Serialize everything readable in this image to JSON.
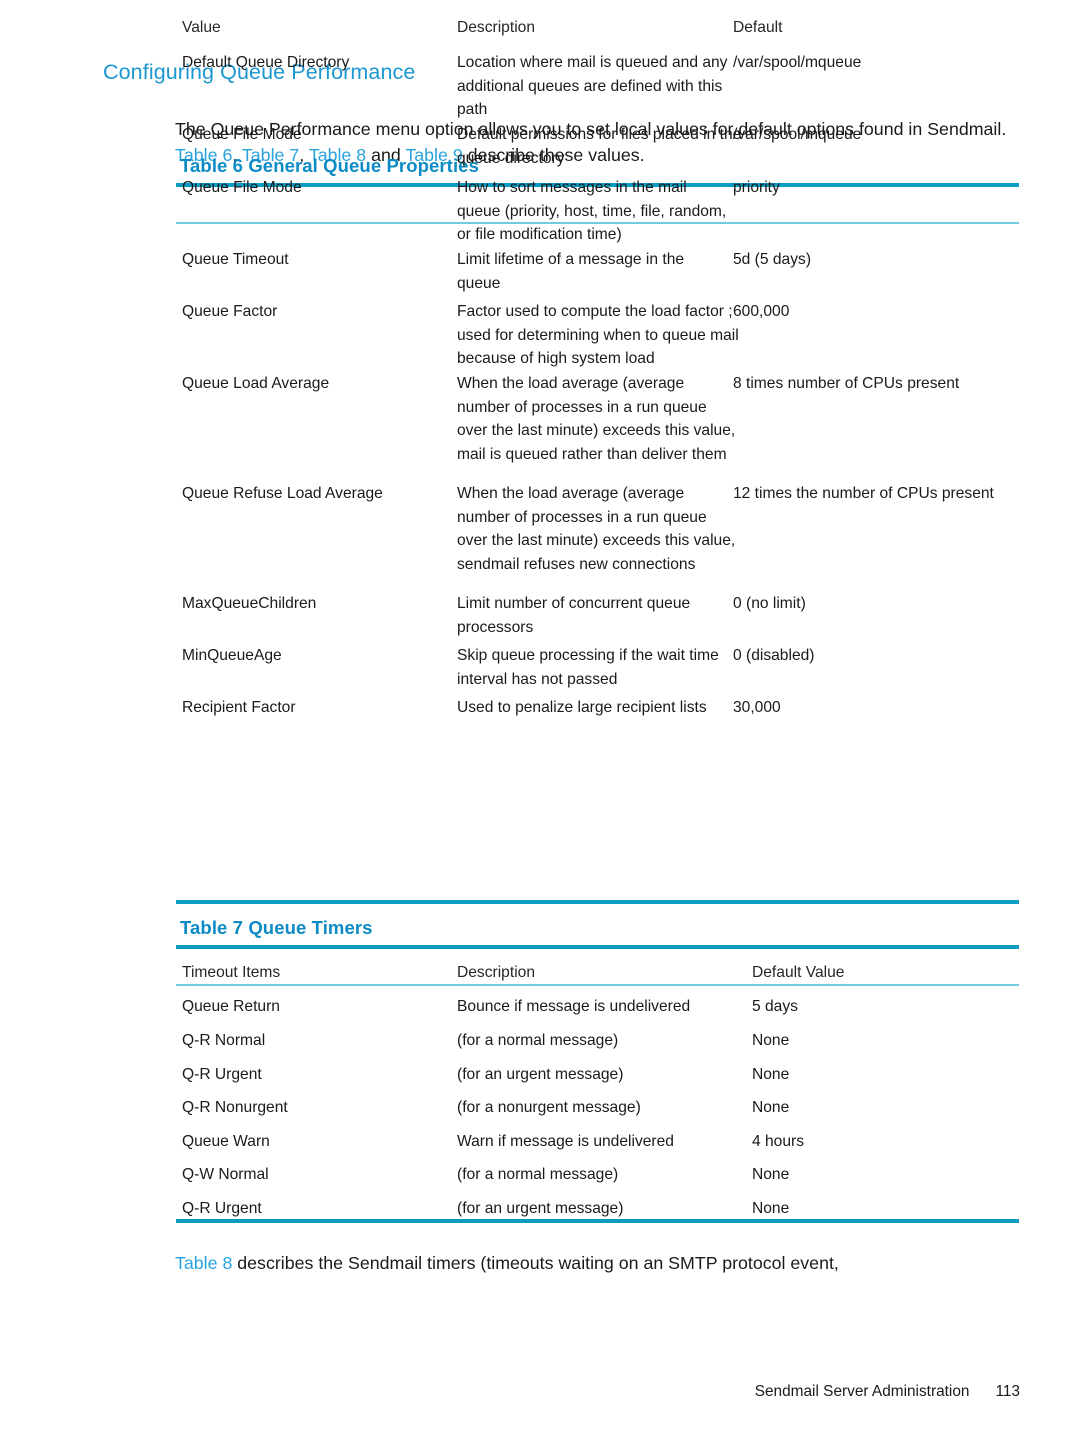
{
  "page": {
    "section_title": "Configuring Queue Performance",
    "intro": {
      "part1": "The Queue Performance menu option allows you to set local values for default options found in Sendmail. ",
      "xref1": "Table 6",
      "sep1": ", ",
      "xref2": "Table 7",
      "sep2": ", ",
      "xref3": "Table 8",
      "sep3": " and ",
      "xref4": "Table 9",
      "part2": " describe these values."
    },
    "outro": {
      "xref": "Table 8",
      "text": " describes the Sendmail timers (timeouts waiting on an SMTP protocol event,"
    },
    "footer": {
      "book_title": "Sendmail Server Administration",
      "page_number": "113"
    },
    "colors": {
      "heading_blue": "#1b97d1",
      "caption_blue": "#0d8bc4",
      "xref_blue": "#29a3dd",
      "rule_heavy": "#0b9cc4",
      "rule_light": "#6ecbe0",
      "body_text": "#1a1a1a"
    }
  },
  "table6": {
    "caption": "Table 6 General Queue Properties",
    "headers": [
      "Value",
      "Description",
      "Default"
    ],
    "rows": [
      {
        "value": "Default Queue Directory",
        "description": "Location where mail is queued and any additional queues are defined with this path",
        "default": "/var/spool/mqueue"
      },
      {
        "value": "Queue File Mode",
        "description": "Default permissions for files placed in the queue directory",
        "default": "/var/spool/mqueue"
      },
      {
        "value": "Queue File Mode",
        "description": "How to sort messages in the mail queue (priority, host, time, file, random, or file modification time)",
        "default": "priority"
      },
      {
        "value": "Queue Timeout",
        "description": "Limit lifetime of a message in the queue",
        "default": "5d (5 days)"
      },
      {
        "value": "Queue Factor",
        "description": "Factor used to compute the load factor ; used for determining when to queue mail because of high system load",
        "default": "600,000"
      },
      {
        "value": "Queue Load Average",
        "description": "When the load average (average number of processes in a run queue over the last minute) exceeds this value, mail is queued rather than deliver them",
        "default": "8 times number of CPUs present"
      },
      {
        "value": "Queue Refuse Load Average",
        "description": "When the load average (average number of processes in a run queue over the last minute) exceeds this value, sendmail refuses new connections",
        "default": "12 times the number of CPUs present"
      },
      {
        "value": "MaxQueueChildren",
        "description": "Limit number of concurrent queue processors",
        "default": "0 (no limit)"
      },
      {
        "value": "MinQueueAge",
        "description": "Skip queue processing if the wait time interval has not passed",
        "default": "0 (disabled)"
      },
      {
        "value": "Recipient Factor",
        "description": "Used to penalize large recipient lists",
        "default": "30,000"
      }
    ]
  },
  "table7": {
    "caption": "Table 7 Queue Timers",
    "headers": [
      "Timeout Items",
      "Description",
      "Default Value"
    ],
    "rows": [
      {
        "value": "Queue Return",
        "description": "Bounce if message is undelivered",
        "default": "5 days"
      },
      {
        "value": "Q-R Normal",
        "description": "(for a normal message)",
        "default": "None"
      },
      {
        "value": "Q-R Urgent",
        "description": "(for an urgent message)",
        "default": "None"
      },
      {
        "value": "Q-R Nonurgent",
        "description": "(for a nonurgent message)",
        "default": "None"
      },
      {
        "value": "Queue Warn",
        "description": "Warn if message is undelivered",
        "default": "4 hours"
      },
      {
        "value": "Q-W Normal",
        "description": "(for a normal message)",
        "default": "None"
      },
      {
        "value": "Q-R Urgent",
        "description": "(for an urgent message)",
        "default": "None"
      }
    ]
  }
}
